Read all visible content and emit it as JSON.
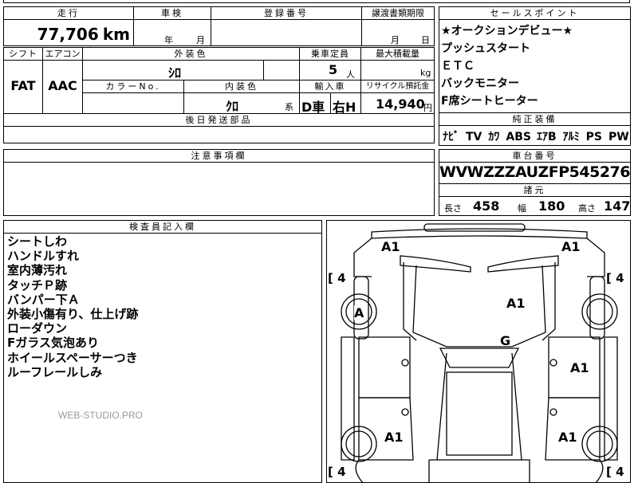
{
  "top_row": {
    "mileage_label": "走行",
    "mileage_value": "77,706",
    "mileage_unit": "km",
    "inspection_label": "車検",
    "inspection_year": "年",
    "inspection_month": "月",
    "registration_label": "登録番号",
    "transfer_label": "譲渡書類期限",
    "transfer_month": "月",
    "transfer_day": "日"
  },
  "row2": {
    "shift_label": "シフト",
    "shift_value": "FAT",
    "ac_label": "エアコン",
    "ac_value": "AAC",
    "exterior_color_label": "外装色",
    "exterior_color_value": "ｼﾛ",
    "capacity_label": "乗車定員",
    "capacity_value": "5",
    "capacity_unit": "人",
    "max_load_label": "最大積載量",
    "max_load_unit": "kg",
    "color_no_label": "カラーNo.",
    "interior_color_label": "内装色",
    "interior_color_value": "ｸﾛ",
    "interior_color_suffix": "系",
    "import_label": "輸入車",
    "import_value1": "D車",
    "import_value2": "右H",
    "recycle_label": "リサイクル預託金",
    "recycle_value": "14,940",
    "recycle_unit": "円"
  },
  "later_parts_label": "後日発送部品",
  "notes_label": "注意事項欄",
  "sales_points": {
    "label": "セールスポイント",
    "items": [
      "★オークションデビュー★",
      "プッシュスタート",
      "ＥＴＣ",
      "バックモニター",
      "F席シートヒーター"
    ]
  },
  "standard_equipment": {
    "label": "純正装備",
    "items": [
      "ﾅﾋﾞ",
      "TV",
      "ｶﾜ",
      "ABS",
      "ｴｱB",
      "ｱﾙﾐ",
      "PS",
      "PW"
    ]
  },
  "chassis": {
    "label": "車台番号",
    "value": "WVWZZZAUZFP545276"
  },
  "dimensions": {
    "label": "諸元",
    "length_label": "長さ",
    "length_value": "458",
    "width_label": "幅",
    "width_value": "180",
    "height_label": "高さ",
    "height_value": "147"
  },
  "inspector": {
    "label": "検査員記入欄",
    "notes": [
      "シートしわ",
      "ハンドルすれ",
      "室内薄汚れ",
      "タッチＰ跡",
      "バンパー下Ａ",
      "外装小傷有り、仕上げ跡",
      "ローダウン",
      "Fガラス気泡あり",
      "ホイールスペーサーつき",
      "ルーフレールしみ"
    ]
  },
  "watermark": "WEB-STUDIO.PRO",
  "diagram": {
    "marks": {
      "front_left": "A1",
      "front_right": "A1",
      "front_left_wheel": "A",
      "hood": "A1",
      "roof": "G",
      "right_door": "A1",
      "rear_left_wheel": "A1",
      "rear_right_wheel": "A1"
    },
    "tires": {
      "fl": "4",
      "fr": "4",
      "rl": "4",
      "rr": "4"
    }
  }
}
